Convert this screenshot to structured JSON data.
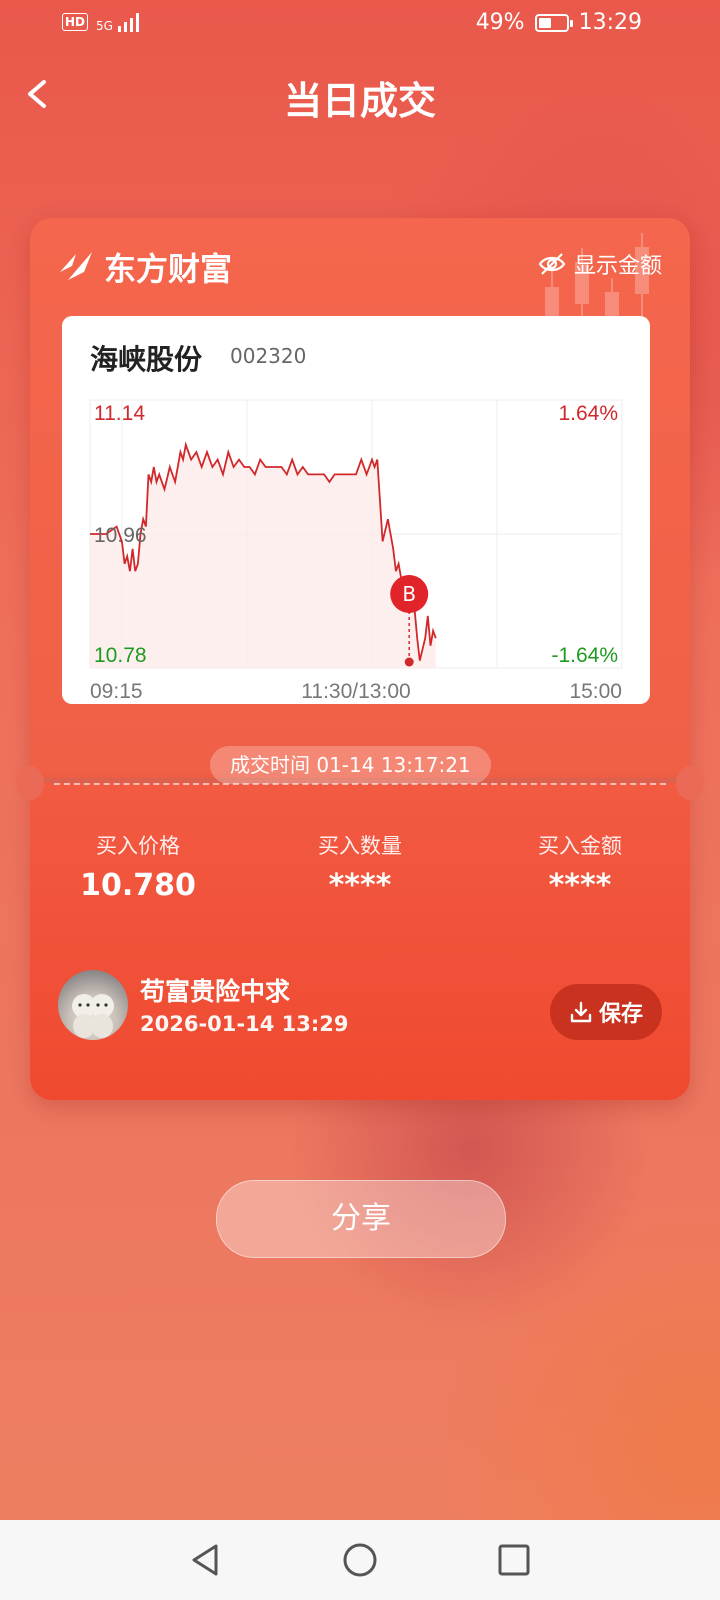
{
  "status_bar": {
    "network_badge": "HD",
    "signal_label": "5G",
    "battery_percent": "49%",
    "battery_level": 0.49,
    "time": "13:29"
  },
  "header": {
    "title": "当日成交"
  },
  "card": {
    "brand_name": "东方财富",
    "show_amount_label": "显示金额",
    "stock": {
      "name": "海峡股份",
      "code": "002320"
    },
    "trade_time_label": "成交时间 01-14 13:17:21",
    "metrics": [
      {
        "label": "买入价格",
        "value": "10.780"
      },
      {
        "label": "买入数量",
        "value": "****"
      },
      {
        "label": "买入金额",
        "value": "****"
      }
    ],
    "user": {
      "name": "苟富贵险中求",
      "datetime": "2026-01-14 13:29"
    },
    "save_label": "保存"
  },
  "chart_data": {
    "type": "line",
    "y_max_label": "11.14",
    "y_mid_label": "10.96",
    "y_min_label": "10.78",
    "pct_max_label": "1.64%",
    "pct_min_label": "-1.64%",
    "x_labels": [
      "09:15",
      "11:30/13:00",
      "15:00"
    ],
    "ylim": [
      10.78,
      11.14
    ],
    "grid": true,
    "colors": {
      "line": "#d0282b",
      "up": "#d0282b",
      "down": "#1f9b1f",
      "area": "#fde8e8"
    },
    "series": [
      {
        "x_frac": [
          0.0,
          0.03,
          0.05,
          0.06,
          0.065,
          0.07,
          0.075,
          0.08,
          0.085,
          0.09,
          0.095,
          0.1,
          0.105,
          0.11,
          0.115,
          0.12,
          0.125,
          0.13,
          0.14,
          0.15,
          0.16,
          0.17,
          0.175,
          0.18,
          0.19,
          0.2,
          0.21,
          0.22,
          0.23,
          0.24,
          0.25,
          0.26,
          0.27,
          0.28,
          0.29,
          0.3,
          0.31,
          0.32,
          0.33,
          0.34,
          0.35,
          0.36,
          0.37,
          0.38,
          0.39,
          0.4,
          0.41,
          0.42,
          0.43,
          0.44,
          0.45,
          0.46,
          0.47,
          0.48,
          0.49,
          0.5,
          0.51,
          0.52,
          0.525,
          0.53,
          0.535,
          0.54,
          0.55,
          0.56,
          0.57,
          0.575,
          0.58,
          0.59,
          0.6,
          0.605,
          0.61,
          0.615,
          0.62,
          0.63,
          0.635,
          0.64,
          0.645,
          0.65
        ],
        "values": [
          10.96,
          10.96,
          10.97,
          10.95,
          10.92,
          10.93,
          10.91,
          10.94,
          10.91,
          10.92,
          10.96,
          10.98,
          10.97,
          11.04,
          11.03,
          11.05,
          11.03,
          11.04,
          11.02,
          11.05,
          11.03,
          11.07,
          11.06,
          11.08,
          11.06,
          11.07,
          11.05,
          11.07,
          11.05,
          11.06,
          11.04,
          11.07,
          11.05,
          11.06,
          11.05,
          11.05,
          11.04,
          11.06,
          11.05,
          11.05,
          11.05,
          11.05,
          11.04,
          11.06,
          11.04,
          11.05,
          11.04,
          11.04,
          11.04,
          11.04,
          11.03,
          11.04,
          11.04,
          11.04,
          11.04,
          11.04,
          11.06,
          11.04,
          11.05,
          11.06,
          11.05,
          11.06,
          10.95,
          10.98,
          10.94,
          10.91,
          10.92,
          10.88,
          10.86,
          10.87,
          10.86,
          10.82,
          10.79,
          10.82,
          10.85,
          10.81,
          10.83,
          10.82
        ]
      }
    ],
    "buy_marker": {
      "label": "B",
      "x_frac": 0.6,
      "value": 10.78
    }
  },
  "share_label": "分享",
  "nav": [
    "back-nav",
    "home-nav",
    "recents-nav"
  ]
}
